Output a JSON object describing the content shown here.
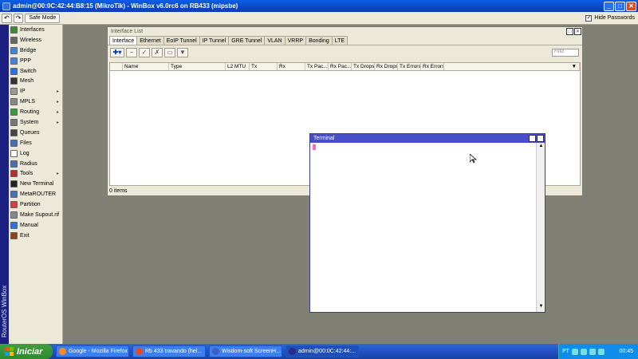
{
  "app": {
    "title": "admin@00:0C:42:44:B8:15 (MikroTik) - WinBox v6.0rc6 on RB433 (mipsbe)",
    "controls": {
      "minimize": "_",
      "maximize": "□",
      "close": "✕"
    }
  },
  "toolbar": {
    "undo": "↶",
    "redo": "↷",
    "safe_mode": "Safe Mode",
    "hide_passwords_label": "Hide Passwords",
    "hide_passwords_checked": "✓"
  },
  "rail": {
    "text": "RouterOS WinBox"
  },
  "sidebar": {
    "items": [
      {
        "label": "Interfaces",
        "icon": "interfaces-icon",
        "color": "#3a8a3a",
        "arrow": ""
      },
      {
        "label": "Wireless",
        "icon": "wireless-icon",
        "color": "#666666",
        "arrow": ""
      },
      {
        "label": "Bridge",
        "icon": "bridge-icon",
        "color": "#4a7fd8",
        "arrow": ""
      },
      {
        "label": "PPP",
        "icon": "ppp-icon",
        "color": "#4a7fd8",
        "arrow": ""
      },
      {
        "label": "Switch",
        "icon": "switch-icon",
        "color": "#2f6fe0",
        "arrow": ""
      },
      {
        "label": "Mesh",
        "icon": "mesh-icon",
        "color": "#333333",
        "arrow": ""
      },
      {
        "label": "IP",
        "icon": "ip-icon",
        "color": "#999999",
        "arrow": "▸"
      },
      {
        "label": "MPLS",
        "icon": "mpls-icon",
        "color": "#888888",
        "arrow": "▸"
      },
      {
        "label": "Routing",
        "icon": "routing-icon",
        "color": "#3a9a3a",
        "arrow": "▸"
      },
      {
        "label": "System",
        "icon": "system-icon",
        "color": "#777777",
        "arrow": "▸"
      },
      {
        "label": "Queues",
        "icon": "queues-icon",
        "color": "#444444",
        "arrow": ""
      },
      {
        "label": "Files",
        "icon": "files-icon",
        "color": "#4a6fb0",
        "arrow": ""
      },
      {
        "label": "Log",
        "icon": "log-icon",
        "color": "#ffffff",
        "arrow": ""
      },
      {
        "label": "Radius",
        "icon": "radius-icon",
        "color": "#4a6fb0",
        "arrow": ""
      },
      {
        "label": "Tools",
        "icon": "tools-icon",
        "color": "#aa3333",
        "arrow": "▸"
      },
      {
        "label": "New Terminal",
        "icon": "terminal-icon",
        "color": "#222222",
        "arrow": ""
      },
      {
        "label": "MetaROUTER",
        "icon": "metarouter-icon",
        "color": "#4a6fb0",
        "arrow": ""
      },
      {
        "label": "Partition",
        "icon": "partition-icon",
        "color": "#d04040",
        "arrow": ""
      },
      {
        "label": "Make Supout.rif",
        "icon": "supout-icon",
        "color": "#888888",
        "arrow": ""
      },
      {
        "label": "Manual",
        "icon": "manual-icon",
        "color": "#2f6fe0",
        "arrow": ""
      },
      {
        "label": "Exit",
        "icon": "exit-icon",
        "color": "#884422",
        "arrow": ""
      }
    ]
  },
  "interface_list": {
    "title": "Interface List",
    "tabs": [
      "Interface",
      "Ethernet",
      "EoIP Tunnel",
      "IP Tunnel",
      "GRE Tunnel",
      "VLAN",
      "VRRP",
      "Bonding",
      "LTE"
    ],
    "find_placeholder": "Find",
    "columns": [
      {
        "label": "",
        "width": 16
      },
      {
        "label": "Name",
        "width": 58
      },
      {
        "label": "Type",
        "width": 71
      },
      {
        "label": "L2 MTU",
        "width": 30
      },
      {
        "label": "Tx",
        "width": 35
      },
      {
        "label": "Rx",
        "width": 35
      },
      {
        "label": "Tx Pac...",
        "width": 29
      },
      {
        "label": "Rx Pac...",
        "width": 29
      },
      {
        "label": "Tx Drops",
        "width": 29
      },
      {
        "label": "Rx Drops",
        "width": 29
      },
      {
        "label": "Tx Errors",
        "width": 29
      },
      {
        "label": "Rx Errors",
        "width": 29
      }
    ],
    "status": "0 items"
  },
  "terminal": {
    "title": "Terminal"
  },
  "taskbar": {
    "start_label": "Iniciar",
    "tasks": [
      {
        "label": "Google - Mozilla Firefox",
        "color": "#ff8a1e"
      },
      {
        "label": "Rb 433 travando (hel...",
        "color": "#e04a2a"
      },
      {
        "label": "Wisdom-soft ScreenH...",
        "color": "#3a60c0"
      },
      {
        "label": "admin@00:0C:42:44:...",
        "color": "#2a2a88"
      }
    ],
    "lang": "PT",
    "clock": "00:45"
  }
}
